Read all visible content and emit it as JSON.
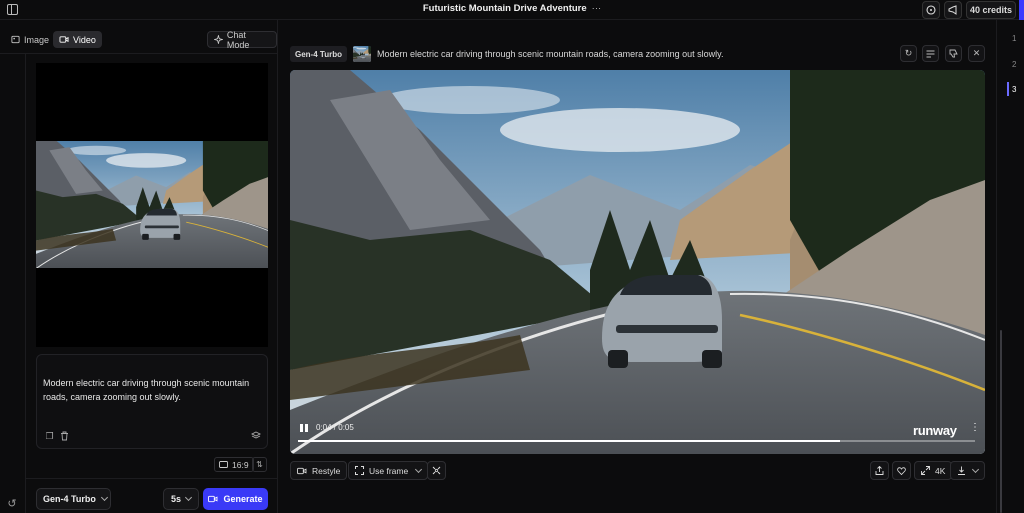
{
  "app": {
    "title": "Futuristic Mountain Drive Adventure",
    "credits": "40 credits",
    "accent_color": "#3a3af7"
  },
  "left_panel": {
    "tabs": [
      {
        "label": "Image",
        "icon": "image-icon",
        "active": false
      },
      {
        "label": "Video",
        "icon": "video-icon",
        "active": true
      }
    ],
    "chat_mode_label": "Chat Mode",
    "prompt": "Modern electric car driving through scenic mountain roads, camera zooming out slowly.",
    "aspect_ratio": "16:9",
    "model": "Gen-4 Turbo",
    "duration": "5s",
    "generate_label": "Generate"
  },
  "generation": {
    "model_badge": "Gen-4 Turbo",
    "prompt": "Modern electric car driving through scenic mountain roads, camera zooming out slowly.",
    "timecode": "0:04 / 0:05",
    "progress": 0.8,
    "watermark": "runway",
    "actions": {
      "restyle_label": "Restyle",
      "use_frame_label": "Use frame",
      "resolution_label": "4K"
    }
  },
  "pagination": [
    "1",
    "2",
    "3"
  ],
  "active_page": "3"
}
